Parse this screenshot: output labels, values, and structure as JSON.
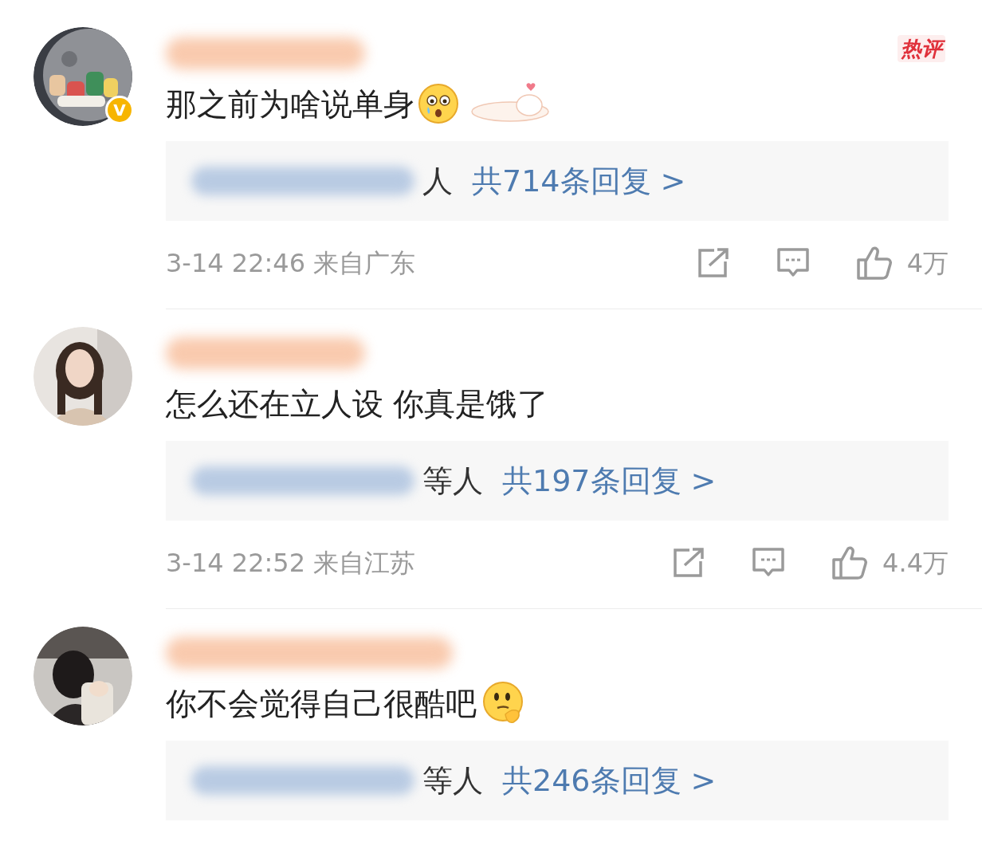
{
  "comments": [
    {
      "hot_label": "热评",
      "verified_badge": "V",
      "text": "那之前为啥说单身",
      "emoji": {
        "kind": "crying"
      },
      "sticker": {
        "kind": "cat"
      },
      "reply_suffix": "人",
      "reply_count": "共714条回复 >",
      "time": "3-14 22:46 来自广东",
      "likes": "4万"
    },
    {
      "text": "怎么还在立人设 你真是饿了",
      "reply_suffix": "等人",
      "reply_count": "共197条回复 >",
      "time": "3-14 22:52 来自江苏",
      "likes": "4.4万"
    },
    {
      "text": "你不会觉得自己很酷吧",
      "emoji": {
        "kind": "thinking"
      },
      "reply_suffix": "等人",
      "reply_count": "共246条回复 >"
    }
  ]
}
